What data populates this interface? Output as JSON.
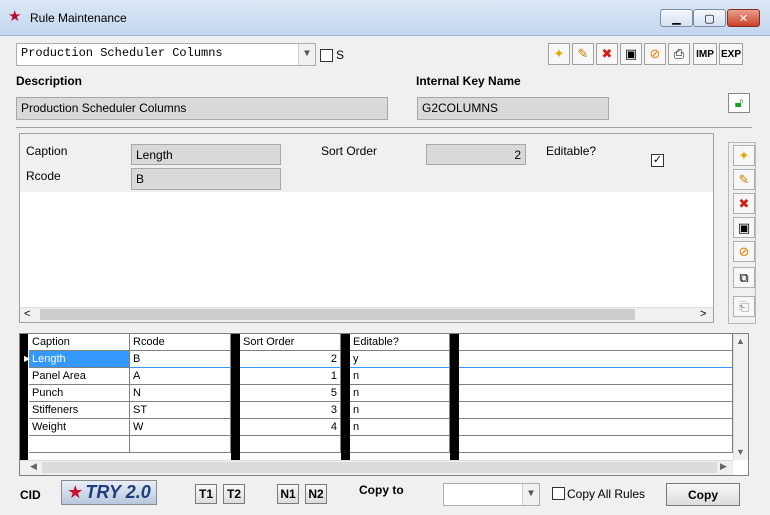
{
  "window": {
    "title": "Rule Maintenance"
  },
  "top": {
    "rule_select": "Production Scheduler Columns",
    "s_label": "S",
    "description_label": "Description",
    "description_value": "Production Scheduler Columns",
    "key_label": "Internal Key Name",
    "key_value": "G2COLUMNS",
    "imp_label": "IMP",
    "exp_label": "EXP"
  },
  "form": {
    "caption_label": "Caption",
    "caption_value": "Length",
    "rcode_label": "Rcode",
    "rcode_value": "B",
    "sort_label": "Sort Order",
    "sort_value": "2",
    "editable_label": "Editable?",
    "editable_checked": "✓"
  },
  "grid": {
    "headers": [
      "Caption",
      "Rcode",
      "Sort Order",
      "Editable?"
    ],
    "rows": [
      [
        "Length",
        "B",
        "2",
        "y"
      ],
      [
        "Panel Area",
        "A",
        "1",
        "n"
      ],
      [
        "Punch",
        "N",
        "5",
        "n"
      ],
      [
        "Stiffeners",
        "ST",
        "3",
        "n"
      ],
      [
        "Weight",
        "W",
        "4",
        "n"
      ]
    ]
  },
  "bottom": {
    "cid_label": "CID",
    "logo_text": "TRY 2.0",
    "t1": "T1",
    "t2": "T2",
    "n1": "N1",
    "n2": "N2",
    "copy_to_label": "Copy to",
    "copy_all_label": "Copy All Rules",
    "copy_button": "Copy"
  },
  "colors": {
    "selected_row": "#3399ff",
    "accent_red": "#b0102e",
    "lock_green": "#1a9a2a"
  }
}
